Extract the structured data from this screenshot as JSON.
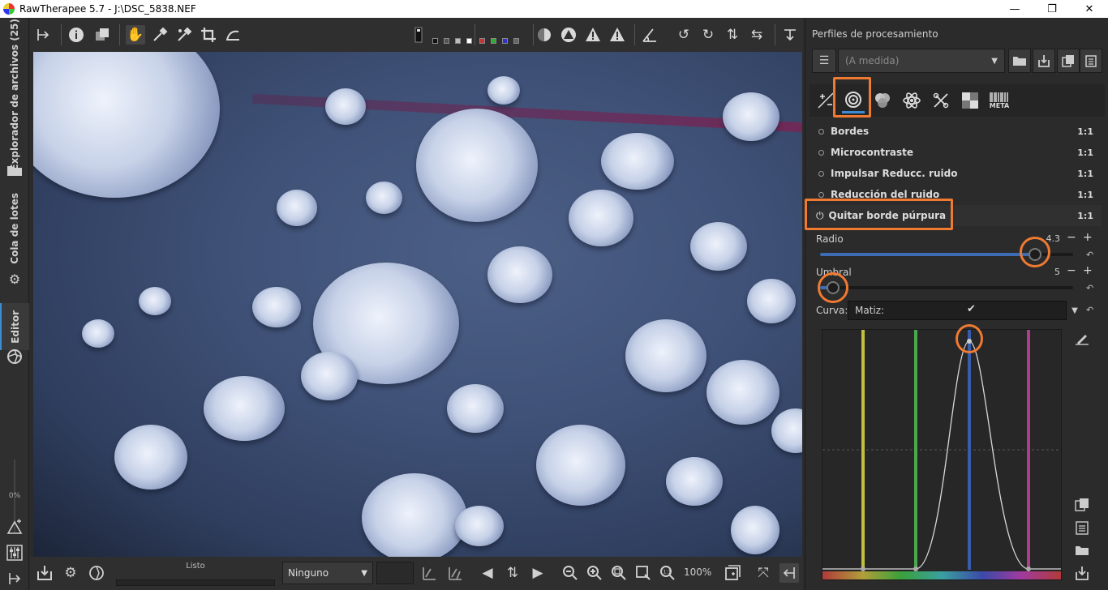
{
  "window": {
    "title": "RawTherapee 5.7 - J:\\DSC_5838.NEF",
    "min_glyph": "—",
    "max_glyph": "❐",
    "close_glyph": "✕"
  },
  "left_tabs": {
    "file_browser": "Explorador de archivos (25)",
    "batch_queue": "Cola de lotes",
    "editor": "Editor",
    "percent": "0%"
  },
  "bottom_bar": {
    "status": "Listo",
    "preview_mode": "Ninguno",
    "zoom": "100%"
  },
  "right_panel": {
    "profiles_title": "Perfiles de procesamiento",
    "profile_value": "(A medida)",
    "tool_tabs": [
      "exposure-tab-icon",
      "detail-tab-icon",
      "color-tab-icon",
      "advanced-tab-icon",
      "transform-tab-icon",
      "raw-tab-icon",
      "metadata-tab-icon"
    ],
    "meta_label": "META",
    "tools": [
      {
        "name": "Bordes",
        "ratio": "1:1"
      },
      {
        "name": "Microcontraste",
        "ratio": "1:1"
      },
      {
        "name": "Impulsar Reducc. ruido",
        "ratio": "1:1"
      },
      {
        "name": "Reducción del ruido",
        "ratio": "1:1"
      },
      {
        "name": "Quitar borde púrpura",
        "ratio": "1:1"
      }
    ],
    "defringe": {
      "radius_label": "Radio",
      "radius_value": "4.3",
      "radius_fraction": 0.85,
      "threshold_label": "Umbral",
      "threshold_value": "5",
      "threshold_fraction": 0.05,
      "curve_label": "Curva:",
      "curve_type": "Matiz:",
      "check_glyph": "✔",
      "minus_glyph": "−",
      "plus_glyph": "+"
    }
  },
  "colors": {
    "accent": "#3d8bd4",
    "highlight": "#f07a32",
    "curve_lines": [
      "#c2c03a",
      "#4ca84c",
      "#3a5ca8",
      "#b43a8e"
    ]
  }
}
